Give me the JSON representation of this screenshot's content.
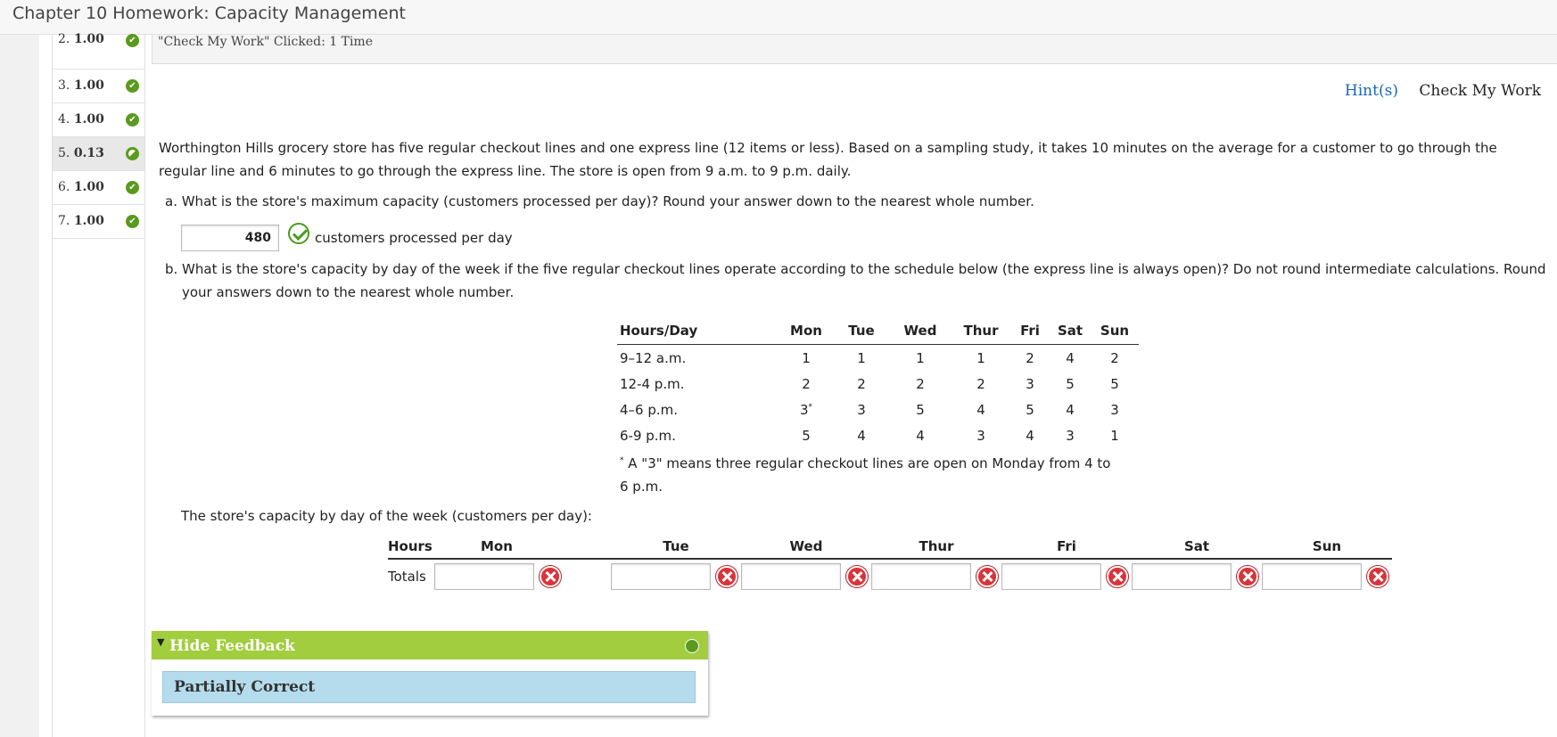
{
  "window": {
    "title": "Chapter 10 Homework: Capacity Management"
  },
  "question_nav": [
    {
      "num": "2.",
      "score": "1.00",
      "status": "correct"
    },
    {
      "num": "3.",
      "score": "1.00",
      "status": "correct"
    },
    {
      "num": "4.",
      "score": "1.00",
      "status": "correct"
    },
    {
      "num": "5.",
      "score": "0.13",
      "status": "partial"
    },
    {
      "num": "6.",
      "score": "1.00",
      "status": "correct"
    },
    {
      "num": "7.",
      "score": "1.00",
      "status": "correct"
    }
  ],
  "check_bar": {
    "text": "\"Check My Work\" Clicked: 1 Time"
  },
  "links": {
    "hints": "Hint(s)",
    "check_my_work": "Check My Work"
  },
  "problem": {
    "intro_line1": "Worthington Hills grocery store has five regular checkout lines and one express line (12 items or less). Based on a sampling study, it takes 10 minutes on the average for a customer to go through the",
    "intro_line2": "regular line and 6 minutes to go through the express line. The store is open from 9 a.m. to 9 p.m. daily.",
    "part_a": "a. What is the store's maximum capacity (customers processed per day)? Round your answer down to the nearest whole number.",
    "part_a_answer": "480",
    "part_a_unit": "customers processed per day",
    "part_b_line1": "b. What is the store's capacity by day of the week if the five regular checkout lines operate according to the schedule below (the express line is always open)? Do not round intermediate calculations. Round",
    "part_b_line2": "your answers down to the nearest whole number."
  },
  "schedule": {
    "headers": [
      "Hours/Day",
      "Mon",
      "Tue",
      "Wed",
      "Thur",
      "Fri",
      "Sat",
      "Sun"
    ],
    "rows": [
      [
        "9–12 a.m.",
        "1",
        "1",
        "1",
        "1",
        "2",
        "4",
        "2"
      ],
      [
        "12-4 p.m.",
        "2",
        "2",
        "2",
        "2",
        "3",
        "5",
        "5"
      ],
      [
        "4–6 p.m.",
        "3",
        "3",
        "5",
        "4",
        "5",
        "4",
        "3"
      ],
      [
        "6-9 p.m.",
        "5",
        "4",
        "4",
        "3",
        "4",
        "3",
        "1"
      ]
    ],
    "footnote_mark": "*",
    "footnote_line1": "A \"3\" means three regular checkout lines are open on Monday from 4 to",
    "footnote_line2": "6 p.m."
  },
  "capacity": {
    "label": "The store's capacity by day of the week (customers per day):",
    "headers": [
      "Hours",
      "Mon",
      "Tue",
      "Wed",
      "Thur",
      "Fri",
      "Sat",
      "Sun"
    ],
    "row_label": "Totals",
    "values": [
      "",
      "",
      "",
      "",
      "",
      "",
      ""
    ]
  },
  "feedback": {
    "toggle": "Hide Feedback",
    "result": "Partially Correct"
  },
  "colors": {
    "correct": "#5a9a1e",
    "incorrect": "#d9343a",
    "feedback_header": "#a1cd3f",
    "feedback_body": "#b5dcec",
    "link": "#1a66b5"
  }
}
